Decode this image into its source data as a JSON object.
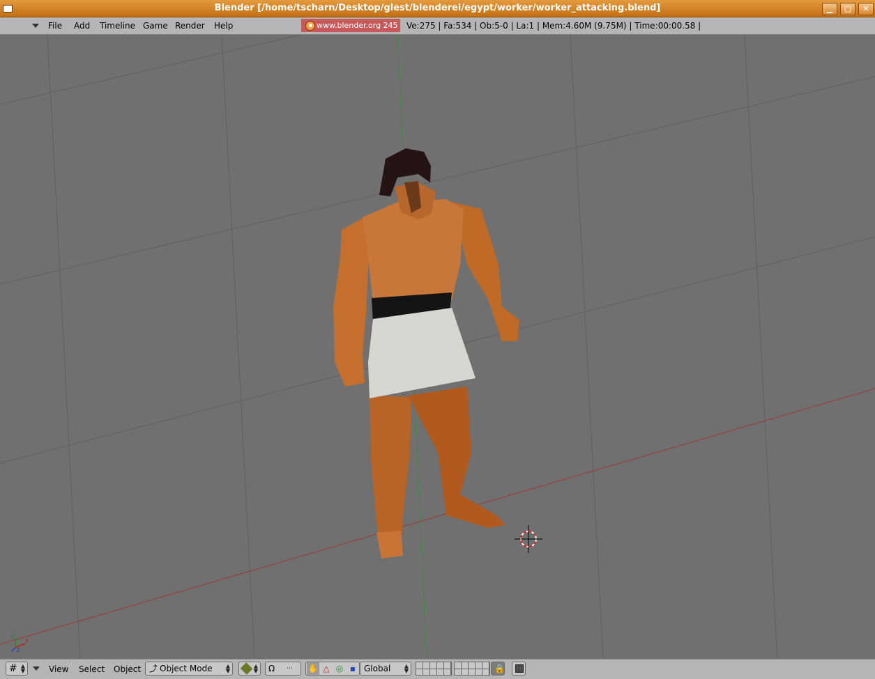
{
  "window": {
    "title": "Blender [/home/tscharn/Desktop/glest/blenderei/egypt/worker/worker_attacking.blend]",
    "minimize_icon": "minimize-icon",
    "maximize_icon": "maximize-icon",
    "close_icon": "close-icon",
    "minimize_glyph": "▁",
    "maximize_glyph": "▢",
    "close_glyph": "✕"
  },
  "info_header": {
    "menus": [
      "File",
      "Add",
      "Timeline",
      "Game",
      "Render",
      "Help"
    ],
    "version_label": "www.blender.org 245",
    "stats": "Ve:275 | Fa:534 | Ob:5-0 | La:1  | Mem:4.60M (9.75M)  | Time:00:00.58 |",
    "version_bg": "#c9585a"
  },
  "viewport": {
    "background": "#707070",
    "grid_color": "#5f5f5f",
    "x_axis_color": "#9a3a3a",
    "y_axis_color": "#3f8a3f",
    "axis_labels": {
      "x": "x",
      "y": "y",
      "z": "z"
    }
  },
  "view3d_header": {
    "menus": [
      "View",
      "Select",
      "Object"
    ],
    "mode_select": "Object Mode",
    "orientation_select": "Global",
    "icons": {
      "editor_type": "grid-icon",
      "draw_type": "textured-cube-icon",
      "pivot": "pivot-icon",
      "manipulator": "hand-icon",
      "translate": "translate-icon",
      "rotate": "rotate-icon",
      "scale": "scale-icon",
      "lock": "lock-icon",
      "render": "render-preview-icon"
    }
  }
}
